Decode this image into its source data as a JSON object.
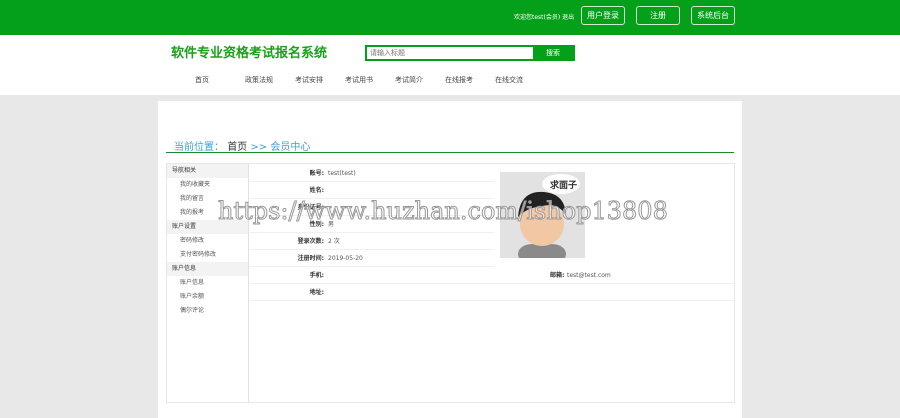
{
  "topbar": {
    "welcome": "欢迎您test(会员) 退出",
    "buttons": [
      "用户登录",
      "注册",
      "系统后台"
    ]
  },
  "header": {
    "title": "软件专业资格考试报名系统",
    "search_placeholder": "请输入标题",
    "search_button": "搜索"
  },
  "nav": [
    "首页",
    "政策法规",
    "考试安排",
    "考试用书",
    "考试简介",
    "在线报考",
    "在线交流"
  ],
  "breadcrumb": {
    "label": "当前位置：",
    "home": "首页",
    "sep": ">>",
    "current": "会员中心"
  },
  "sidebar": [
    {
      "title": "导航相关",
      "items": [
        "我的收藏夹",
        "我的留言",
        "我的报考"
      ]
    },
    {
      "title": "账户设置",
      "items": [
        "密码修改",
        "支付密码修改"
      ]
    },
    {
      "title": "账户信息",
      "items": [
        "账户信息",
        "账户余额",
        "偶尔评论"
      ]
    }
  ],
  "profile": {
    "account_label": "账号:",
    "account": "test(test)",
    "name_label": "姓名:",
    "name": "",
    "id_label": "身份证号:",
    "id": "",
    "gender_label": "性别:",
    "gender": "男",
    "logins_label": "登录次数:",
    "logins": "2 次",
    "reg_label": "注册时间:",
    "reg": "2019-05-20",
    "phone_label": "手机:",
    "phone": "",
    "email_label": "邮箱:",
    "email": "test@test.com",
    "addr_label": "地址:",
    "addr": "",
    "avatar_caption": "求面子"
  },
  "watermark": "https://www.huzhan.com/ishop13808"
}
